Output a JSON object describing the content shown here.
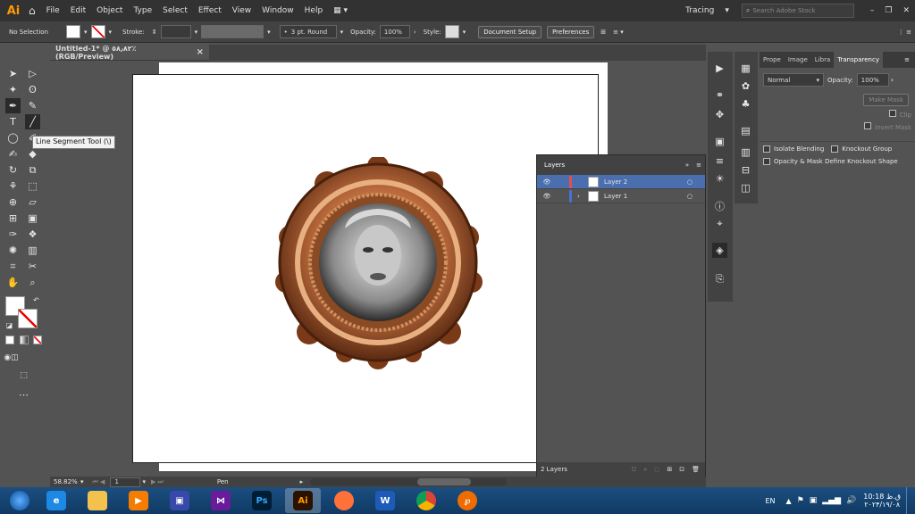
{
  "app": {
    "logo": "Ai",
    "workspace": "Tracing",
    "search_placeholder": "Search Adobe Stock"
  },
  "menu": [
    "File",
    "Edit",
    "Object",
    "Type",
    "Select",
    "Effect",
    "View",
    "Window",
    "Help"
  ],
  "control": {
    "selection": "No Selection",
    "stroke_label": "Stroke:",
    "brush": "3 pt. Round",
    "opacity_label": "Opacity:",
    "opacity_value": "100%",
    "style_label": "Style:",
    "doc_setup": "Document Setup",
    "preferences": "Preferences"
  },
  "doc_tab": {
    "title": "Untitled-1* @ ٥٨٫٨٢٪ (RGB/Preview)",
    "close": "×"
  },
  "tooltip": "Line Segment Tool (\\)",
  "layers": {
    "title": "Layers",
    "rows": [
      {
        "name": "Layer 2",
        "color": "#e05050",
        "selected": true
      },
      {
        "name": "Layer 1",
        "color": "#4a6fd8",
        "selected": false
      }
    ],
    "count": "2 Layers"
  },
  "transparency": {
    "tabs": [
      "Prope",
      "Image",
      "Libra",
      "Transparency"
    ],
    "blend": "Normal",
    "opacity_label": "Opacity:",
    "opacity_value": "100%",
    "make_mask": "Make Mask",
    "clip": "Clip",
    "invert": "Invert Mask",
    "isolate": "Isolate Blending",
    "knockout": "Knockout Group",
    "opacity_mask": "Opacity & Mask Define Knockout Shape"
  },
  "status": {
    "zoom": "58.82%",
    "page": "1",
    "tool": "Pen"
  },
  "taskbar": {
    "lang": "EN",
    "time": "10:18 ق.ظ",
    "date": "۲۰۲۴/۱۹/۰۸"
  },
  "colors": {
    "accent": "#ff9a00",
    "menubar": "#323232",
    "panel": "#535353"
  }
}
